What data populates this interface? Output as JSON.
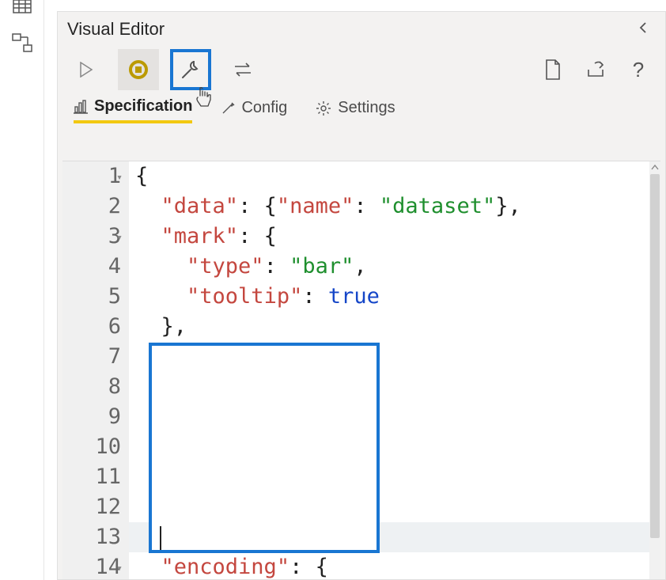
{
  "panel": {
    "title": "Visual Editor"
  },
  "toolbar": {
    "play": "Play",
    "stop": "Stop",
    "repair": "Repair",
    "swap": "Swap",
    "newdoc": "New",
    "export": "Export",
    "help": "?"
  },
  "tabs": {
    "spec": "Specification",
    "config": "Config",
    "settings": "Settings"
  },
  "code": {
    "lines": [
      {
        "n": "1",
        "fold": true,
        "segs": [
          {
            "t": "{",
            "c": "punc"
          }
        ]
      },
      {
        "n": "2",
        "fold": false,
        "segs": [
          {
            "t": "  ",
            "c": ""
          },
          {
            "t": "\"data\"",
            "c": "key"
          },
          {
            "t": ": {",
            "c": "punc"
          },
          {
            "t": "\"name\"",
            "c": "key"
          },
          {
            "t": ": ",
            "c": "punc"
          },
          {
            "t": "\"dataset\"",
            "c": "str"
          },
          {
            "t": "},",
            "c": "punc"
          }
        ]
      },
      {
        "n": "3",
        "fold": true,
        "segs": [
          {
            "t": "  ",
            "c": ""
          },
          {
            "t": "\"mark\"",
            "c": "key"
          },
          {
            "t": ": {",
            "c": "punc"
          }
        ]
      },
      {
        "n": "4",
        "fold": false,
        "segs": [
          {
            "t": "    ",
            "c": ""
          },
          {
            "t": "\"type\"",
            "c": "key"
          },
          {
            "t": ": ",
            "c": "punc"
          },
          {
            "t": "\"bar\"",
            "c": "str"
          },
          {
            "t": ",",
            "c": "punc"
          }
        ]
      },
      {
        "n": "5",
        "fold": false,
        "segs": [
          {
            "t": "    ",
            "c": ""
          },
          {
            "t": "\"tooltip\"",
            "c": "key"
          },
          {
            "t": ": ",
            "c": "punc"
          },
          {
            "t": "true",
            "c": "bool"
          }
        ]
      },
      {
        "n": "6",
        "fold": false,
        "segs": [
          {
            "t": "  },",
            "c": "punc"
          }
        ]
      },
      {
        "n": "7",
        "fold": false,
        "segs": []
      },
      {
        "n": "8",
        "fold": false,
        "segs": []
      },
      {
        "n": "9",
        "fold": false,
        "segs": []
      },
      {
        "n": "10",
        "fold": false,
        "segs": []
      },
      {
        "n": "11",
        "fold": false,
        "segs": []
      },
      {
        "n": "12",
        "fold": false,
        "segs": []
      },
      {
        "n": "13",
        "fold": false,
        "current": true,
        "segs": []
      },
      {
        "n": "14",
        "fold": true,
        "segs": [
          {
            "t": "  ",
            "c": ""
          },
          {
            "t": "\"encoding\"",
            "c": "key"
          },
          {
            "t": ": {",
            "c": "punc"
          }
        ]
      }
    ]
  }
}
